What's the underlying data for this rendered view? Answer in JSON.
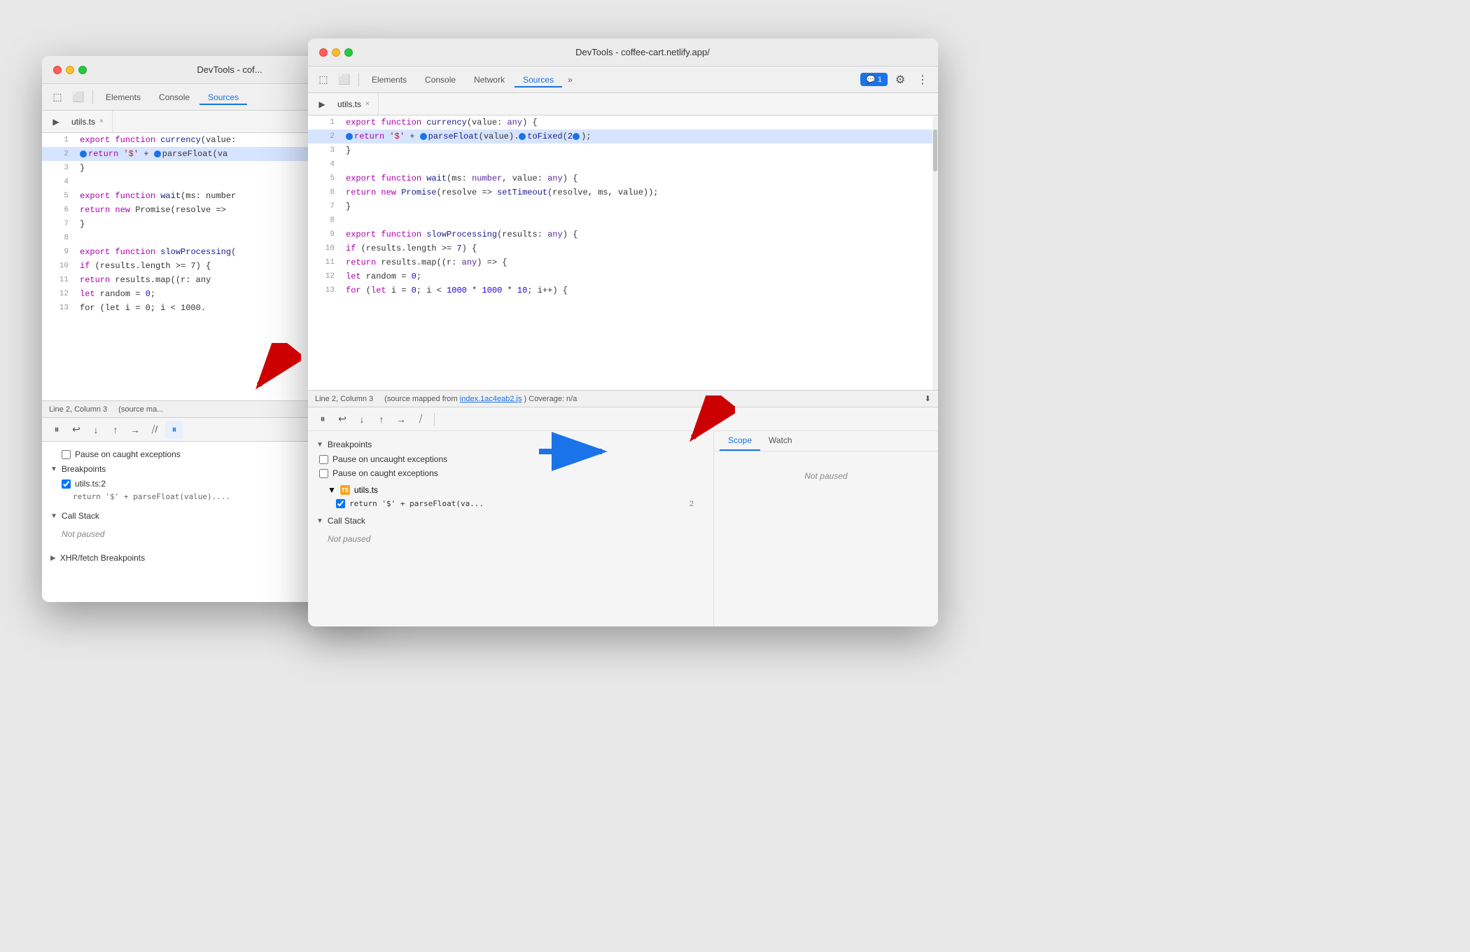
{
  "window1": {
    "title": "DevTools - cof...",
    "tabs": [
      "Elements",
      "Console",
      "Source..."
    ],
    "activeTab": "Sources",
    "fileTab": "utils.ts",
    "statusBar": {
      "position": "Line 2, Column 3",
      "sourceMap": "(source ma..."
    },
    "debugToolbar": {
      "buttons": [
        "pause",
        "resume",
        "stepOver",
        "stepInto",
        "stepOut",
        "stepOutAlt",
        "debugScript",
        "breakpoints"
      ]
    },
    "checkboxLabel": "Pause on caught exceptions",
    "sections": {
      "breakpoints": {
        "label": "Breakpoints",
        "items": [
          {
            "file": "utils.ts:2",
            "code": "return '$' + parseFloat(value)...."
          }
        ]
      },
      "callStack": {
        "label": "Call Stack",
        "notPaused": "Not paused"
      },
      "xhrBreakpoints": {
        "label": "XHR/fetch Breakpoints"
      }
    }
  },
  "window2": {
    "title": "DevTools - coffee-cart.netlify.app/",
    "tabs": [
      "Elements",
      "Console",
      "Network",
      "Sources"
    ],
    "activeTab": "Sources",
    "fileTab": "utils.ts",
    "code": {
      "lines": [
        {
          "num": 1,
          "text": "export function currency(value: any) {",
          "highlighted": false
        },
        {
          "num": 2,
          "text": "  ►return '$' + ►parseFloat(value).►toFixed(2►);",
          "highlighted": true,
          "raw": true
        },
        {
          "num": 3,
          "text": "}",
          "highlighted": false
        },
        {
          "num": 4,
          "text": "",
          "highlighted": false
        },
        {
          "num": 5,
          "text": "export function wait(ms: number, value: any) {",
          "highlighted": false
        },
        {
          "num": 6,
          "text": "    return new Promise(resolve => setTimeout(resolve, ms, value));",
          "highlighted": false
        },
        {
          "num": 7,
          "text": "}",
          "highlighted": false
        },
        {
          "num": 8,
          "text": "",
          "highlighted": false
        },
        {
          "num": 9,
          "text": "export function slowProcessing(results: any) {",
          "highlighted": false
        },
        {
          "num": 10,
          "text": "    if (results.length >= 7) {",
          "highlighted": false
        },
        {
          "num": 11,
          "text": "        return results.map((r: any) => {",
          "highlighted": false
        },
        {
          "num": 12,
          "text": "            let random = 0;",
          "highlighted": false
        },
        {
          "num": 13,
          "text": "            for (let i = 0; i < 1000 * 1000 * 10; i++) {",
          "highlighted": false
        }
      ]
    },
    "statusBar": {
      "position": "Line 2, Column 3",
      "sourceMap": "(source mapped from ",
      "sourceFile": "index.1ac4eab2.js",
      "coverage": ") Coverage: n/a"
    },
    "debugToolbar": {
      "buttons": [
        "pause",
        "resume",
        "stepOver",
        "stepInto",
        "stepOut",
        "stepOutAlt",
        "breakpoints"
      ]
    },
    "bottomPanel": {
      "breakpoints": {
        "label": "Breakpoints",
        "items": [
          {
            "checkbox_uncaught": "Pause on uncaught exceptions",
            "checkbox_caught": "Pause on caught exceptions",
            "file": "utils.ts",
            "code": "return '$' + parseFloat(va...",
            "lineNum": "2"
          }
        ]
      },
      "callStack": {
        "label": "Call Stack",
        "notPaused": "Not paused"
      }
    },
    "rightPanel": {
      "tabs": [
        "Scope",
        "Watch"
      ],
      "activeTab": "Scope",
      "notPaused": "Not paused"
    }
  },
  "annotations": {
    "blueArrow": "→",
    "redArrow1": "↙",
    "redArrow2": "↙"
  }
}
